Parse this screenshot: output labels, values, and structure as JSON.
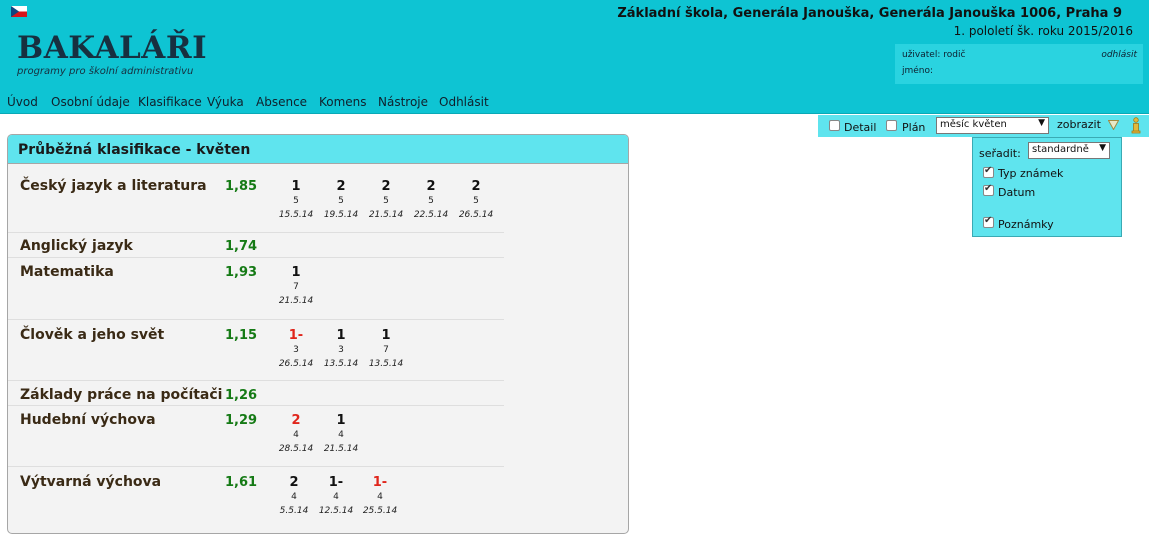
{
  "header": {
    "flag_icon": "czech-flag-icon",
    "logo_title": "BAKALÁŘI",
    "logo_subtitle": "programy pro školní administrativu",
    "school_name": "Základní škola, Generála Janouška, Generála Janouška 1006, Praha 9",
    "school_term": "1. pololetí šk. roku 2015/2016",
    "user_label": "uživatel: rodič",
    "name_label": "jméno:",
    "logout_label": "odhlásit"
  },
  "nav": {
    "items": [
      "Úvod",
      "Osobní údaje",
      "Klasifikace",
      "Výuka",
      "Absence",
      "Komens",
      "Nástroje",
      "Odhlásit"
    ]
  },
  "toolbar": {
    "detail_label": "Detail",
    "plan_label": "Plán",
    "period_value": "měsíc květen",
    "show_label": "zobrazit",
    "filter_icon": "filter-triangle-icon",
    "info_icon": "info-icon"
  },
  "dropdown": {
    "sort_label": "seřadit:",
    "sort_value": "standardně",
    "options": [
      {
        "label": "Typ známek",
        "checked": true
      },
      {
        "label": "Datum",
        "checked": true
      },
      {
        "label": "Poznámky",
        "checked": true
      }
    ]
  },
  "panel": {
    "title": "Průběžná klasifikace - květen",
    "subjects": [
      {
        "name": "Český jazyk a literatura",
        "average": "1,85",
        "grades": [
          {
            "value": "1",
            "weight": "5",
            "date": "15.5.14",
            "red": false
          },
          {
            "value": "2",
            "weight": "5",
            "date": "19.5.14",
            "red": false
          },
          {
            "value": "2",
            "weight": "5",
            "date": "21.5.14",
            "red": false
          },
          {
            "value": "2",
            "weight": "5",
            "date": "22.5.14",
            "red": false
          },
          {
            "value": "2",
            "weight": "5",
            "date": "26.5.14",
            "red": false
          }
        ]
      },
      {
        "name": "Anglický jazyk",
        "average": "1,74",
        "grades": []
      },
      {
        "name": "Matematika",
        "average": "1,93",
        "grades": [
          {
            "value": "1",
            "weight": "7",
            "date": "21.5.14",
            "red": false
          }
        ]
      },
      {
        "name": "Člověk a jeho svět",
        "average": "1,15",
        "grades": [
          {
            "value": "1-",
            "weight": "3",
            "date": "26.5.14",
            "red": true
          },
          {
            "value": "1",
            "weight": "3",
            "date": "13.5.14",
            "red": false
          },
          {
            "value": "1",
            "weight": "7",
            "date": "13.5.14",
            "red": false
          }
        ]
      },
      {
        "name": "Základy práce na počítači",
        "average": "1,26",
        "grades": []
      },
      {
        "name": "Hudební výchova",
        "average": "1,29",
        "grades": [
          {
            "value": "2",
            "weight": "4",
            "date": "28.5.14",
            "red": true
          },
          {
            "value": "1",
            "weight": "4",
            "date": "21.5.14",
            "red": false
          }
        ]
      },
      {
        "name": "Výtvarná výchova",
        "average": "1,61",
        "grades": [
          {
            "value": "2",
            "weight": "4",
            "date": "5.5.14",
            "red": false
          },
          {
            "value": "1-",
            "weight": "4",
            "date": "12.5.14",
            "red": false
          },
          {
            "value": "1-",
            "weight": "4",
            "date": "25.5.14",
            "red": true
          }
        ]
      }
    ]
  }
}
